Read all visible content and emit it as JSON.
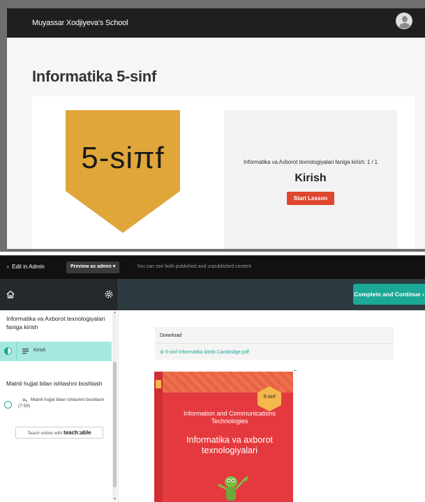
{
  "top": {
    "school_name": "Muyassar Xodjiyeva's School",
    "course_title": "Informatika 5-sinf",
    "cover_label": "5-siπf",
    "cover_partial_text": "",
    "lesson_subtitle": "Informatika va Axborot texnologiyalari faniga kirish: 1 / 1",
    "lesson_name": "Kirish",
    "start_button": "Start Lesson"
  },
  "admin_bar": {
    "edit_label": "Edit in Admin",
    "preview_label": "Preview as admin",
    "note": "You can see both published and unpublished content"
  },
  "topbar": {
    "complete_label": "Complete and Continue"
  },
  "sidebar": {
    "sections": [
      {
        "title": "Informatika va Axborot texnologiyalari faniga kirish",
        "lessons": [
          {
            "label": "Kirish"
          }
        ]
      },
      {
        "title": "Matnli hujjat bilan ishlashni boshlash",
        "lessons": [
          {
            "label": "Matnli hujjat bilan ishlashni boshlash (7:59)"
          }
        ]
      }
    ],
    "teach_prefix": "Teach online with",
    "teach_brand": "teach:able"
  },
  "content": {
    "download_heading": "Download",
    "download_file": "5-sinf Informatika kitobi Cambridge.pdf"
  },
  "book": {
    "badge": "5-sinf",
    "title_en": "Information and Communications Technologies",
    "title_uz": "Informatika va axborot texnologiyalari"
  },
  "colors": {
    "accent": "#1ba896",
    "start_button": "#e0452e",
    "active_lesson_bg": "#a6e8df",
    "header_dark": "#1f1f1f",
    "book_red": "#e43a3f",
    "cover_orange": "#e0a63a"
  },
  "icons": [
    "chevron-left-icon",
    "caret-down-icon",
    "home-icon",
    "gear-icon",
    "chevron-right-icon",
    "half-circle-icon",
    "text-lines-icon",
    "empty-circle-icon",
    "text-x-icon",
    "download-icon",
    "user-icon"
  ]
}
